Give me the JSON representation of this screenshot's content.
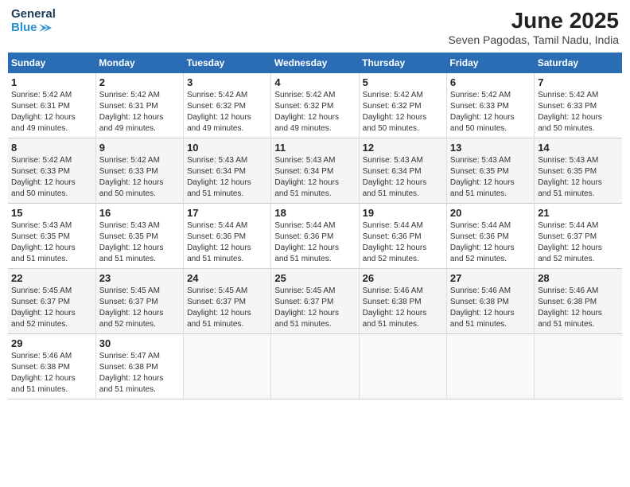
{
  "header": {
    "logo_line1": "General",
    "logo_line2": "Blue",
    "title": "June 2025",
    "subtitle": "Seven Pagodas, Tamil Nadu, India"
  },
  "weekdays": [
    "Sunday",
    "Monday",
    "Tuesday",
    "Wednesday",
    "Thursday",
    "Friday",
    "Saturday"
  ],
  "weeks": [
    [
      {
        "day": "1",
        "info": "Sunrise: 5:42 AM\nSunset: 6:31 PM\nDaylight: 12 hours\nand 49 minutes."
      },
      {
        "day": "2",
        "info": "Sunrise: 5:42 AM\nSunset: 6:31 PM\nDaylight: 12 hours\nand 49 minutes."
      },
      {
        "day": "3",
        "info": "Sunrise: 5:42 AM\nSunset: 6:32 PM\nDaylight: 12 hours\nand 49 minutes."
      },
      {
        "day": "4",
        "info": "Sunrise: 5:42 AM\nSunset: 6:32 PM\nDaylight: 12 hours\nand 49 minutes."
      },
      {
        "day": "5",
        "info": "Sunrise: 5:42 AM\nSunset: 6:32 PM\nDaylight: 12 hours\nand 50 minutes."
      },
      {
        "day": "6",
        "info": "Sunrise: 5:42 AM\nSunset: 6:33 PM\nDaylight: 12 hours\nand 50 minutes."
      },
      {
        "day": "7",
        "info": "Sunrise: 5:42 AM\nSunset: 6:33 PM\nDaylight: 12 hours\nand 50 minutes."
      }
    ],
    [
      {
        "day": "8",
        "info": "Sunrise: 5:42 AM\nSunset: 6:33 PM\nDaylight: 12 hours\nand 50 minutes."
      },
      {
        "day": "9",
        "info": "Sunrise: 5:42 AM\nSunset: 6:33 PM\nDaylight: 12 hours\nand 50 minutes."
      },
      {
        "day": "10",
        "info": "Sunrise: 5:43 AM\nSunset: 6:34 PM\nDaylight: 12 hours\nand 51 minutes."
      },
      {
        "day": "11",
        "info": "Sunrise: 5:43 AM\nSunset: 6:34 PM\nDaylight: 12 hours\nand 51 minutes."
      },
      {
        "day": "12",
        "info": "Sunrise: 5:43 AM\nSunset: 6:34 PM\nDaylight: 12 hours\nand 51 minutes."
      },
      {
        "day": "13",
        "info": "Sunrise: 5:43 AM\nSunset: 6:35 PM\nDaylight: 12 hours\nand 51 minutes."
      },
      {
        "day": "14",
        "info": "Sunrise: 5:43 AM\nSunset: 6:35 PM\nDaylight: 12 hours\nand 51 minutes."
      }
    ],
    [
      {
        "day": "15",
        "info": "Sunrise: 5:43 AM\nSunset: 6:35 PM\nDaylight: 12 hours\nand 51 minutes."
      },
      {
        "day": "16",
        "info": "Sunrise: 5:43 AM\nSunset: 6:35 PM\nDaylight: 12 hours\nand 51 minutes."
      },
      {
        "day": "17",
        "info": "Sunrise: 5:44 AM\nSunset: 6:36 PM\nDaylight: 12 hours\nand 51 minutes."
      },
      {
        "day": "18",
        "info": "Sunrise: 5:44 AM\nSunset: 6:36 PM\nDaylight: 12 hours\nand 51 minutes."
      },
      {
        "day": "19",
        "info": "Sunrise: 5:44 AM\nSunset: 6:36 PM\nDaylight: 12 hours\nand 52 minutes."
      },
      {
        "day": "20",
        "info": "Sunrise: 5:44 AM\nSunset: 6:36 PM\nDaylight: 12 hours\nand 52 minutes."
      },
      {
        "day": "21",
        "info": "Sunrise: 5:44 AM\nSunset: 6:37 PM\nDaylight: 12 hours\nand 52 minutes."
      }
    ],
    [
      {
        "day": "22",
        "info": "Sunrise: 5:45 AM\nSunset: 6:37 PM\nDaylight: 12 hours\nand 52 minutes."
      },
      {
        "day": "23",
        "info": "Sunrise: 5:45 AM\nSunset: 6:37 PM\nDaylight: 12 hours\nand 52 minutes."
      },
      {
        "day": "24",
        "info": "Sunrise: 5:45 AM\nSunset: 6:37 PM\nDaylight: 12 hours\nand 51 minutes."
      },
      {
        "day": "25",
        "info": "Sunrise: 5:45 AM\nSunset: 6:37 PM\nDaylight: 12 hours\nand 51 minutes."
      },
      {
        "day": "26",
        "info": "Sunrise: 5:46 AM\nSunset: 6:38 PM\nDaylight: 12 hours\nand 51 minutes."
      },
      {
        "day": "27",
        "info": "Sunrise: 5:46 AM\nSunset: 6:38 PM\nDaylight: 12 hours\nand 51 minutes."
      },
      {
        "day": "28",
        "info": "Sunrise: 5:46 AM\nSunset: 6:38 PM\nDaylight: 12 hours\nand 51 minutes."
      }
    ],
    [
      {
        "day": "29",
        "info": "Sunrise: 5:46 AM\nSunset: 6:38 PM\nDaylight: 12 hours\nand 51 minutes."
      },
      {
        "day": "30",
        "info": "Sunrise: 5:47 AM\nSunset: 6:38 PM\nDaylight: 12 hours\nand 51 minutes."
      },
      {
        "day": "",
        "info": ""
      },
      {
        "day": "",
        "info": ""
      },
      {
        "day": "",
        "info": ""
      },
      {
        "day": "",
        "info": ""
      },
      {
        "day": "",
        "info": ""
      }
    ]
  ]
}
